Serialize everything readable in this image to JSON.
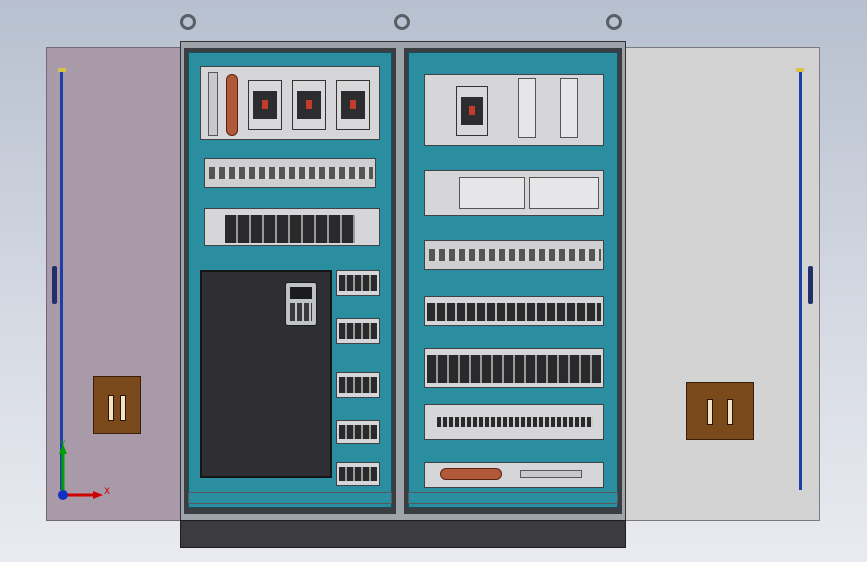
{
  "scene": {
    "description_visible": "",
    "axis": {
      "x_label": "X",
      "y_label": "Y"
    }
  },
  "colors": {
    "panel_teal": "#2b8da0",
    "rod_blue": "#1d3fa8",
    "plate_brown": "#7a4a1c",
    "axis_red": "#d00000",
    "axis_green": "#00a000",
    "axis_blue": "#1030c0"
  },
  "components": {
    "left_cabinet": [
      "terminal-rail",
      "copper-busbar",
      "breaker",
      "breaker",
      "breaker",
      "fuse-row",
      "relay-row",
      "vfd-drive",
      "relay-block",
      "relay-block",
      "relay-block",
      "relay-block",
      "relay-block"
    ],
    "right_cabinet": [
      "main-breaker",
      "power-supply",
      "power-supply",
      "plc-row",
      "fuse-row",
      "terminal-row",
      "relay-row",
      "terminal-strip",
      "copper-busbar",
      "terminal-rail"
    ]
  }
}
